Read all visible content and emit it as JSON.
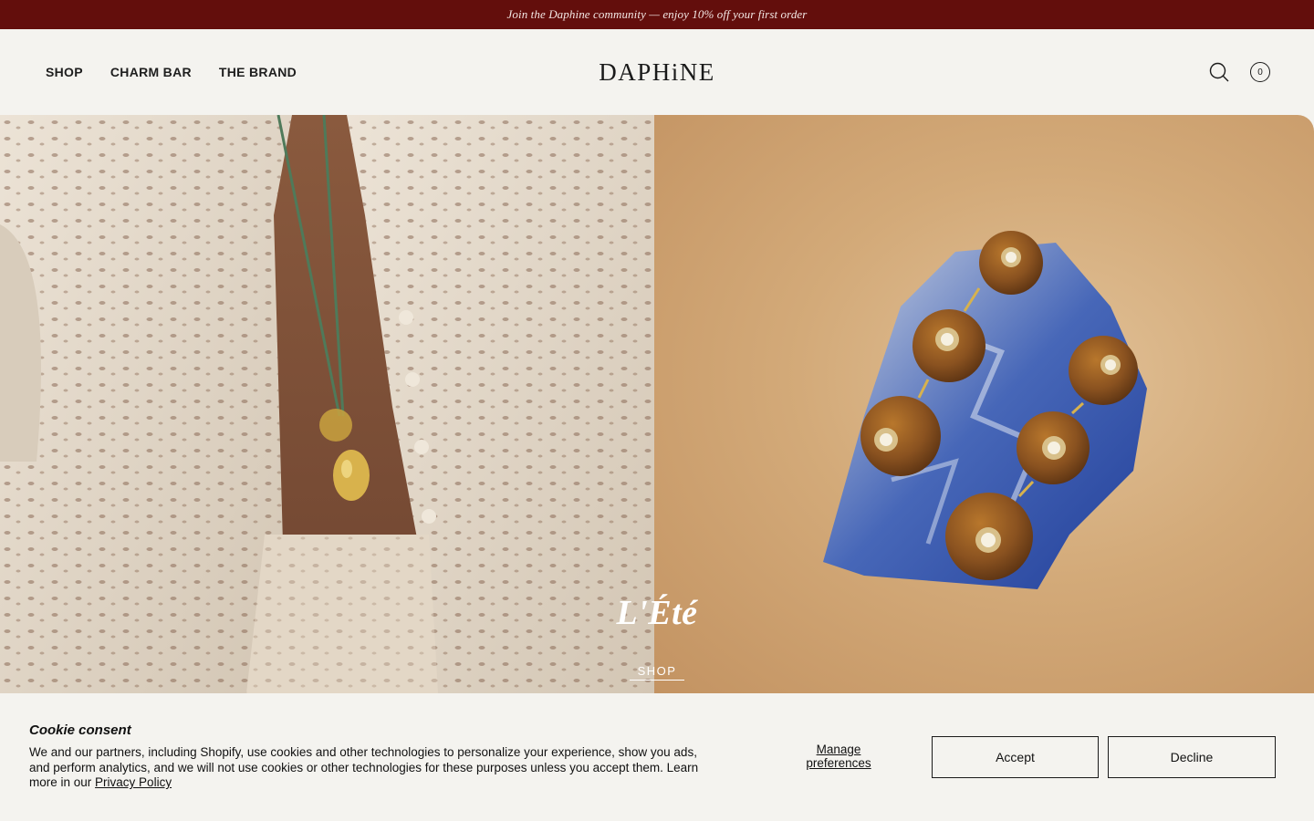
{
  "announcement": {
    "text": "Join the Daphine community — enjoy 10% off your first order"
  },
  "header": {
    "nav": [
      {
        "label": "SHOP"
      },
      {
        "label": "CHARM BAR"
      },
      {
        "label": "THE BRAND"
      }
    ],
    "logo": "DAPHiNE",
    "icons": {
      "search": "search-icon",
      "cart": "cart-icon"
    },
    "cart_count": "0"
  },
  "hero": {
    "title": "L'Été",
    "cta": "SHOP"
  },
  "cookie": {
    "title": "Cookie consent",
    "body": "We and our partners, including Shopify, use cookies and other technologies to personalize your experience, show you ads, and perform analytics, and we will not use cookies or other technologies for these purposes unless you accept them. Learn more in our",
    "link": "Privacy Policy",
    "manage": "Manage preferences",
    "accept": "Accept",
    "decline": "Decline"
  },
  "colors": {
    "announcement_bg": "#630e0c",
    "page_bg": "#f4f3ef",
    "text": "#1a1a1a"
  }
}
